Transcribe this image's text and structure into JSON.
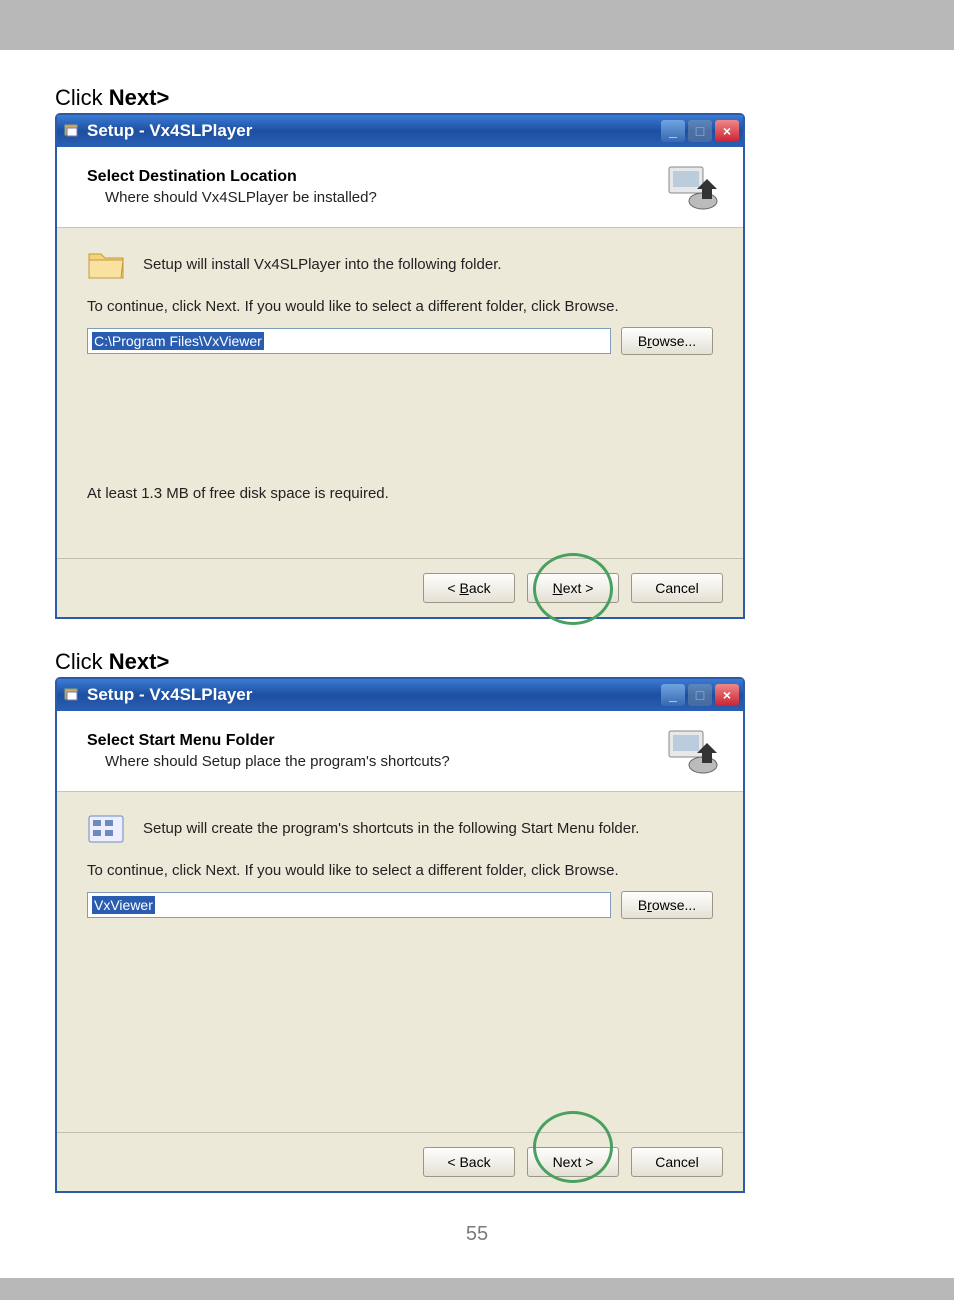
{
  "page_number": "55",
  "instructions": {
    "line1_prefix": "Click ",
    "line1_bold": "Next>",
    "line2_prefix": "Click ",
    "line2_bold": "Next>"
  },
  "window1": {
    "title": "Setup - Vx4SLPlayer",
    "header_title": "Select Destination Location",
    "header_sub": "Where should Vx4SLPlayer be installed?",
    "icon_row_text": "Setup will install Vx4SLPlayer into the following folder.",
    "continue_text": "To continue, click Next. If you would like to select a different folder, click Browse.",
    "path_value": "C:\\Program Files\\VxViewer",
    "browse_label": "Browse...",
    "disk_text": "At least 1.3 MB of free disk space is required.",
    "back_label": "< Back",
    "back_underline": "B",
    "next_label": "Next >",
    "next_underline": "N",
    "cancel_label": "Cancel"
  },
  "window2": {
    "title": "Setup - Vx4SLPlayer",
    "header_title": "Select Start Menu Folder",
    "header_sub": "Where should Setup place the program's shortcuts?",
    "icon_row_text": "Setup will create the program's shortcuts in the following Start Menu folder.",
    "continue_text": "To continue, click Next. If you would like to select a different folder, click Browse.",
    "path_value": "VxViewer",
    "browse_label": "Browse...",
    "back_label": "< Back",
    "next_label": "Next >",
    "cancel_label": "Cancel"
  }
}
